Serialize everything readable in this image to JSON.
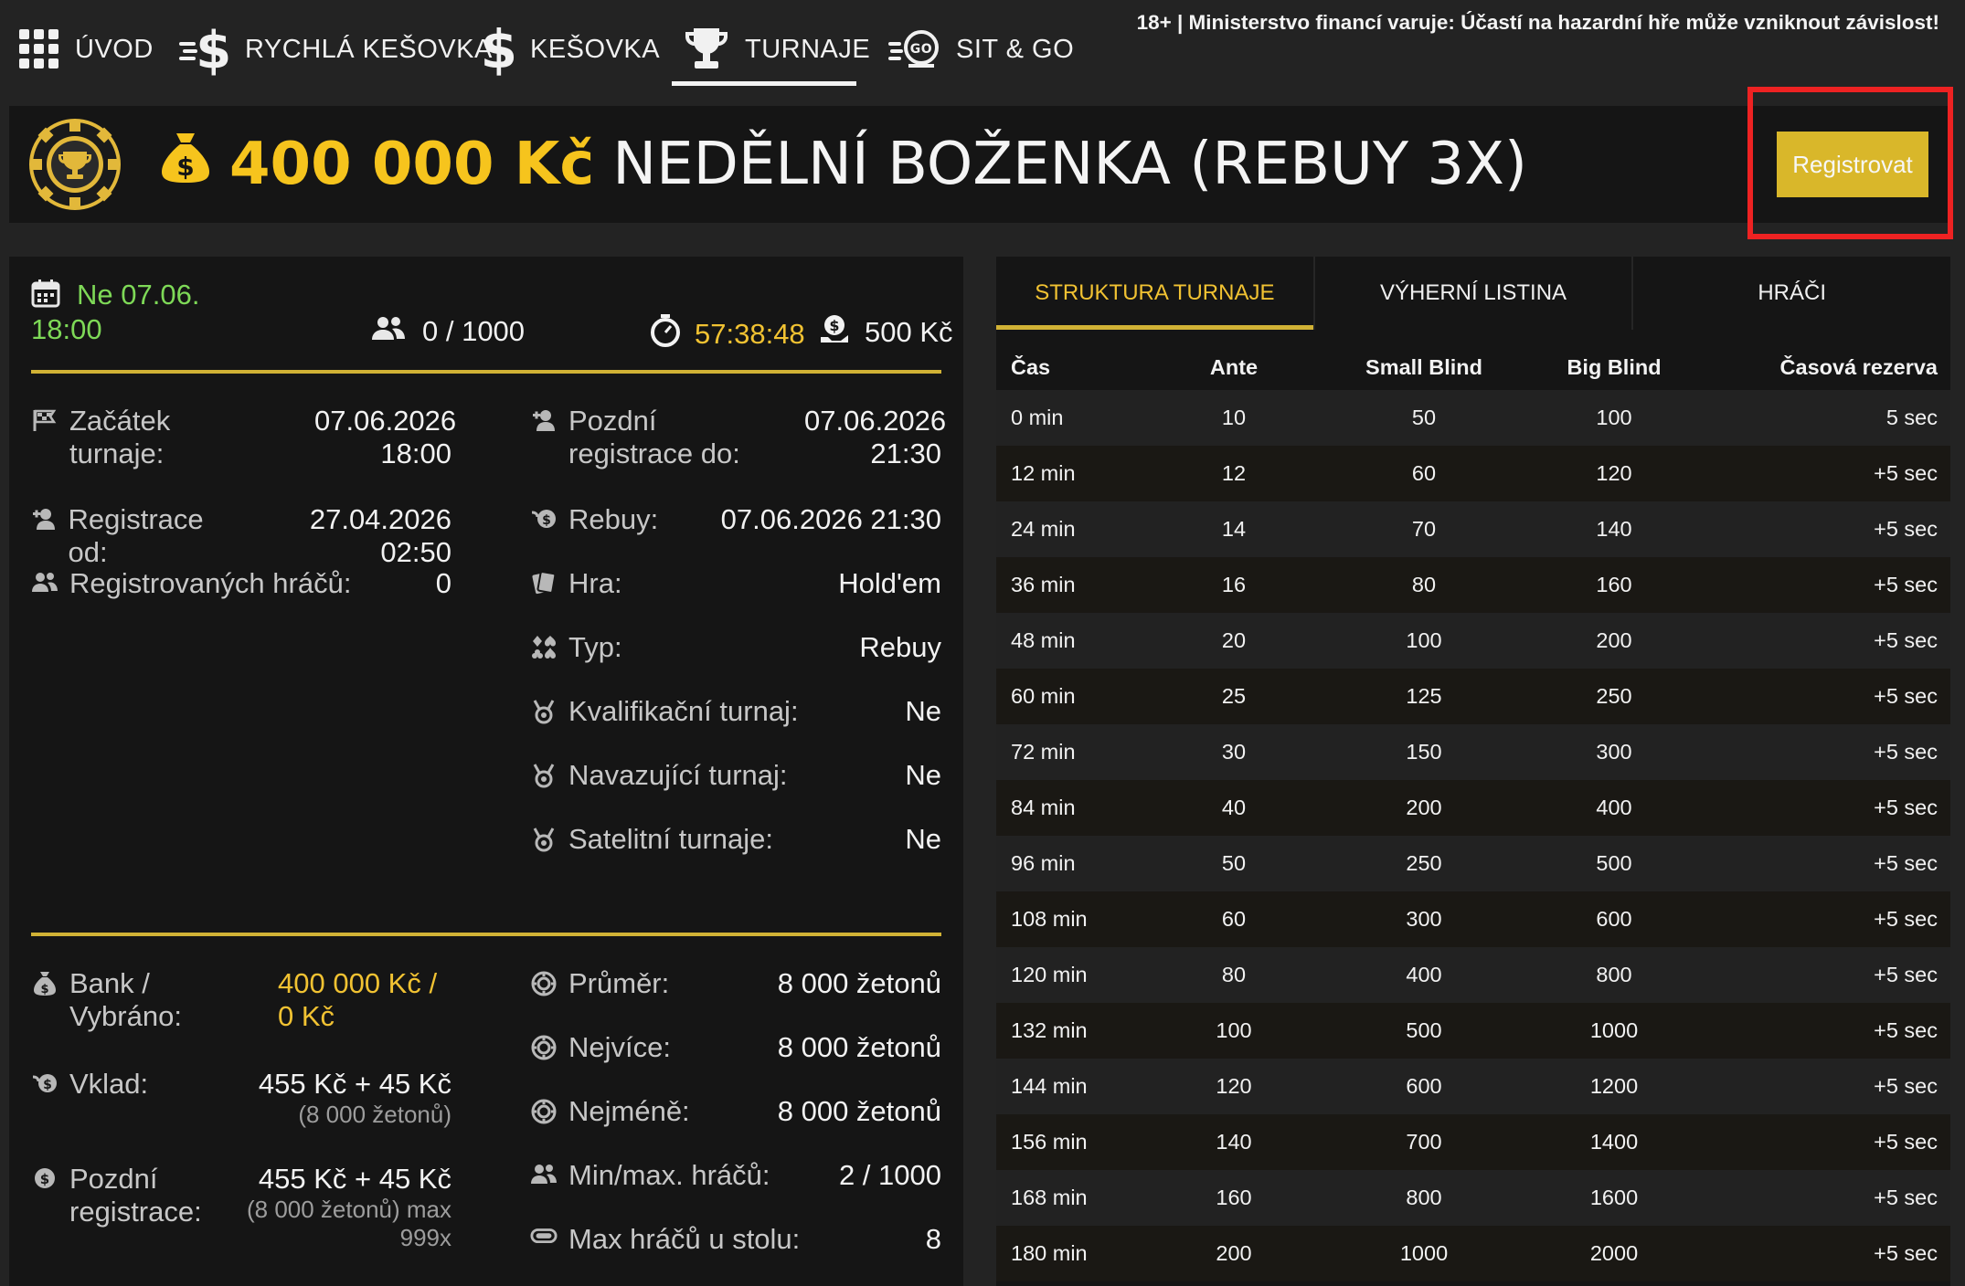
{
  "nav": {
    "items": [
      {
        "label": "ÚVOD",
        "icon": "grid-icon"
      },
      {
        "label": "RYCHLÁ KEŠOVKA",
        "icon": "fast-dollar-icon"
      },
      {
        "label": "KEŠOVKA",
        "icon": "dollar-icon"
      },
      {
        "label": "TURNAJE",
        "icon": "trophy-icon"
      },
      {
        "label": "SIT & GO",
        "icon": "go-chip-icon"
      }
    ],
    "active": "TURNAJE",
    "warning": "18+ | Ministerstvo financí varuje: Účastí na hazardní hře může vzniknout závislost!"
  },
  "tournament": {
    "prize": "400 000 Kč",
    "name": "NEDĚLNÍ BOŽENKA (REBUY 3X)",
    "register_label": "Registrovat"
  },
  "summary": {
    "date": "Ne 07.06.",
    "time": "18:00",
    "players": "0 / 1000",
    "countdown": "57:38:48",
    "buyin": "500 Kč"
  },
  "details_left": [
    {
      "label": "Začátek turnaje:",
      "value": "07.06.2026 18:00",
      "icon": "flag-icon"
    },
    {
      "label": "Registrace od:",
      "value": "27.04.2026 02:50",
      "icon": "user-add-icon"
    },
    {
      "label": "Registrovaných hráčů:",
      "value": "0",
      "icon": "users-icon"
    }
  ],
  "details_right": [
    {
      "label": "Pozdní registrace do:",
      "value": "07.06.2026 21:30",
      "icon": "user-add-icon"
    },
    {
      "label": "Rebuy:",
      "value": "07.06.2026 21:30",
      "icon": "rebuy-icon"
    },
    {
      "label": "Hra:",
      "value": "Hold'em",
      "icon": "cards-icon"
    },
    {
      "label": "Typ:",
      "value": "Rebuy",
      "icon": "suits-icon"
    },
    {
      "label": "Kvalifikační turnaj:",
      "value": "Ne",
      "icon": "medal-icon"
    },
    {
      "label": "Navazující turnaj:",
      "value": "Ne",
      "icon": "medal-icon"
    },
    {
      "label": "Satelitní turnaje:",
      "value": "Ne",
      "icon": "medal-icon"
    }
  ],
  "finance_left": {
    "bank_label": "Bank / Vybráno:",
    "bank_value": "400 000 Kč / 0 Kč",
    "deposit_label": "Vklad:",
    "deposit_value": "455 Kč + 45 Kč",
    "deposit_sub": "(8 000 žetonů)",
    "late_label": "Pozdní registrace:",
    "late_value": "455 Kč + 45 Kč",
    "late_sub": "(8 000 žetonů) max 999x"
  },
  "finance_right": [
    {
      "label": "Průměr:",
      "value": "8 000 žetonů",
      "icon": "chip-icon"
    },
    {
      "label": "Nejvíce:",
      "value": "8 000 žetonů",
      "icon": "chip-icon"
    },
    {
      "label": "Nejméně:",
      "value": "8 000 žetonů",
      "icon": "chip-icon"
    },
    {
      "label": "Min/max. hráčů:",
      "value": "2 / 1000",
      "icon": "users-icon"
    },
    {
      "label": "Max hráčů u stolu:",
      "value": "8",
      "icon": "table-icon"
    }
  ],
  "tabs": [
    "STRUKTURA TURNAJE",
    "VÝHERNÍ LISTINA",
    "HRÁČI"
  ],
  "blinds": {
    "headers": [
      "Čas",
      "Ante",
      "Small Blind",
      "Big Blind",
      "Časová rezerva"
    ],
    "rows": [
      [
        "0 min",
        "10",
        "50",
        "100",
        "5 sec"
      ],
      [
        "12 min",
        "12",
        "60",
        "120",
        "+5 sec"
      ],
      [
        "24 min",
        "14",
        "70",
        "140",
        "+5 sec"
      ],
      [
        "36 min",
        "16",
        "80",
        "160",
        "+5 sec"
      ],
      [
        "48 min",
        "20",
        "100",
        "200",
        "+5 sec"
      ],
      [
        "60 min",
        "25",
        "125",
        "250",
        "+5 sec"
      ],
      [
        "72 min",
        "30",
        "150",
        "300",
        "+5 sec"
      ],
      [
        "84 min",
        "40",
        "200",
        "400",
        "+5 sec"
      ],
      [
        "96 min",
        "50",
        "250",
        "500",
        "+5 sec"
      ],
      [
        "108 min",
        "60",
        "300",
        "600",
        "+5 sec"
      ],
      [
        "120 min",
        "80",
        "400",
        "800",
        "+5 sec"
      ],
      [
        "132 min",
        "100",
        "500",
        "1000",
        "+5 sec"
      ],
      [
        "144 min",
        "120",
        "600",
        "1200",
        "+5 sec"
      ],
      [
        "156 min",
        "140",
        "700",
        "1400",
        "+5 sec"
      ],
      [
        "168 min",
        "160",
        "800",
        "1600",
        "+5 sec"
      ],
      [
        "180 min",
        "200",
        "1000",
        "2000",
        "+5 sec"
      ]
    ]
  },
  "colors": {
    "gold": "#f1c232",
    "green": "#7ed957",
    "highlight": "#ee2222",
    "button": "#d9b72a"
  }
}
